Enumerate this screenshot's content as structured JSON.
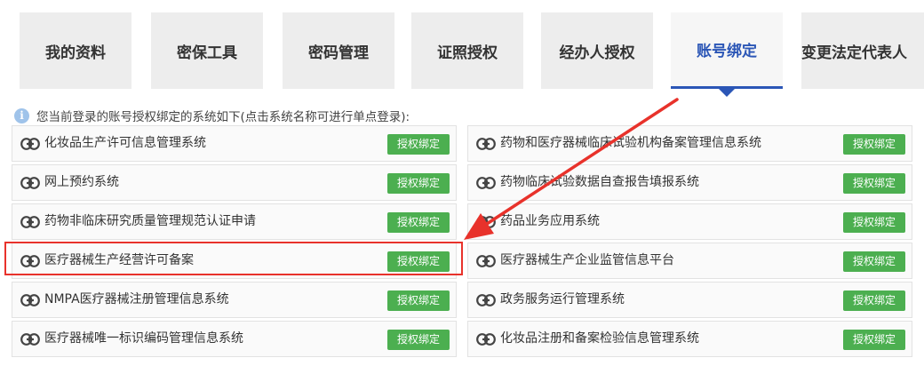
{
  "tabs": [
    {
      "label": "我的资料",
      "active": false
    },
    {
      "label": "密保工具",
      "active": false
    },
    {
      "label": "密码管理",
      "active": false
    },
    {
      "label": "证照授权",
      "active": false
    },
    {
      "label": "经办人授权",
      "active": false
    },
    {
      "label": "账号绑定",
      "active": true
    },
    {
      "label": "变更法定代表人",
      "active": false
    }
  ],
  "notice": {
    "icon": "info-icon",
    "text": "您当前登录的账号授权绑定的系统如下(点击系统名称可进行单点登录):"
  },
  "systems": {
    "left": [
      {
        "name": "化妆品生产许可信息管理系统",
        "button": "授权绑定"
      },
      {
        "name": "网上预约系统",
        "button": "授权绑定"
      },
      {
        "name": "药物非临床研究质量管理规范认证申请",
        "button": "授权绑定"
      },
      {
        "name": "医疗器械生产经营许可备案",
        "button": "授权绑定"
      },
      {
        "name": "NMPA医疗器械注册管理信息系统",
        "button": "授权绑定"
      },
      {
        "name": "医疗器械唯一标识编码管理信息系统",
        "button": "授权绑定"
      }
    ],
    "right": [
      {
        "name": "药物和医疗器械临床试验机构备案管理信息系统",
        "button": "授权绑定"
      },
      {
        "name": "药物临床试验数据自查报告填报系统",
        "button": "授权绑定"
      },
      {
        "name": "药品业务应用系统",
        "button": "授权绑定"
      },
      {
        "name": "医疗器械生产企业监管信息平台",
        "button": "授权绑定"
      },
      {
        "name": "政务服务运行管理系统",
        "button": "授权绑定"
      },
      {
        "name": "化妆品注册和备案检验信息管理系统",
        "button": "授权绑定"
      }
    ]
  },
  "colors": {
    "active_tab": "#2b56b6",
    "button_green": "#4caf50",
    "annotation_red": "#e8322b"
  },
  "annotation": {
    "highlighted_system": "医疗器械生产经营许可备案"
  }
}
